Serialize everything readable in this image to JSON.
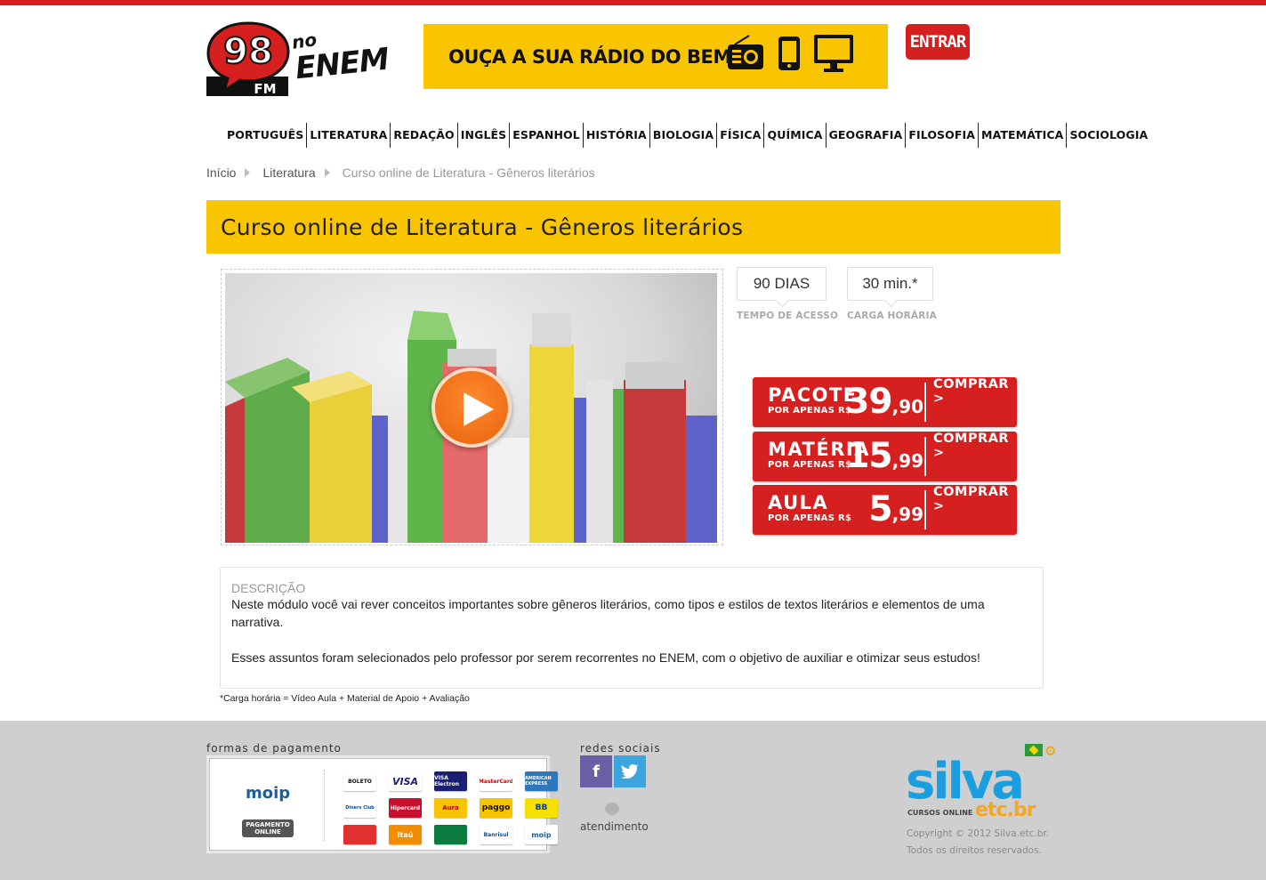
{
  "header": {
    "logo_number": "98",
    "logo_fm": "FM",
    "logo_no": "no",
    "logo_enem": "ENEM",
    "radio_banner_text": "OUÇA A SUA RÁDIO DO BEM!",
    "login_label": "ENTRAR"
  },
  "nav": {
    "items": [
      "PORTUGUÊS",
      "LITERATURA",
      "REDAÇÃO",
      "INGLÊS",
      "ESPANHOL",
      "HISTÓRIA",
      "BIOLOGIA",
      "FÍSICA",
      "QUÍMICA",
      "GEOGRAFIA",
      "FILOSOFIA",
      "MATEMÁTICA",
      "SOCIOLOGIA"
    ]
  },
  "breadcrumb": {
    "home": "Início",
    "category": "Literatura",
    "current": "Curso online de Literatura - Gêneros literários"
  },
  "course": {
    "title": "Curso online de Literatura - Gêneros literários",
    "access_value": "90 DIAS",
    "access_label": "TEMPO DE ACESSO",
    "workload_value": "30 min.*",
    "workload_label": "CARGA HORÁRIA"
  },
  "offers": [
    {
      "name": "PACOTE",
      "sub": "POR APENAS R$",
      "price": "39",
      "cents": ",90",
      "cta": "COMPRAR >"
    },
    {
      "name": "MATÉRIA",
      "sub": "POR APENAS R$",
      "price": "15",
      "cents": ",99",
      "cta": "COMPRAR >"
    },
    {
      "name": "AULA",
      "sub": "POR APENAS R$",
      "price": "5",
      "cents": ",99",
      "cta": "COMPRAR >"
    }
  ],
  "description": {
    "title": "DESCRIÇÃO",
    "p1": "Neste módulo você vai rever conceitos importantes sobre gêneros literários, como tipos e estilos de textos literários e elementos de uma narrativa.",
    "p2": "Esses assuntos foram selecionados pelo professor por serem recorrentes no ENEM, com o objetivo de auxiliar e otimizar seus estudos!"
  },
  "footnote": "*Carga horária = Vídeo Aula + Material de Apoio + Avaliação",
  "footer": {
    "payment_label": "formas de pagamento",
    "moip": "moip",
    "pagamento_online": "PAGAMENTO ONLINE",
    "cards": [
      "BOLETO",
      "VISA",
      "VISA Electron",
      "MasterCard",
      "AMERICAN EXPRESS",
      "Diners Club",
      "Hipercard",
      "Aura",
      "paggo",
      "BB",
      "",
      "Itaú",
      "",
      "Banrisul",
      "moip"
    ],
    "social_label": "redes sociais",
    "facebook": "f",
    "atendimento": "atendimento",
    "brand": "silva",
    "brand_sub": "CURSOS ONLINE",
    "brand_domain": "etc.br",
    "copyright_line1": "Copyright © 2012 Silva.etc.br.",
    "copyright_line2": "Todos os direitos reservados."
  },
  "colors": {
    "brand_red": "#d61f1f",
    "brand_yellow": "#f9c400",
    "silva_blue": "#1a9ee0"
  }
}
